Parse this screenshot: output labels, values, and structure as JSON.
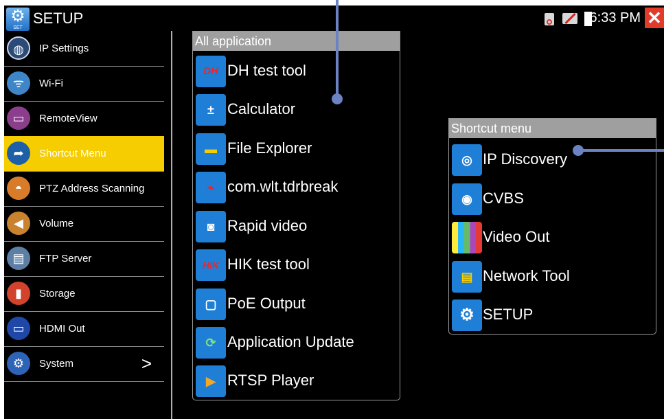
{
  "window": {
    "title": "SETUP",
    "icon": "setup-gear-icon",
    "icon_caption": "SET"
  },
  "status_bar": {
    "time": "6:33 PM",
    "icons": [
      "sd-card-icon",
      "network-disconnected-icon",
      "battery-icon"
    ],
    "close": "close-icon"
  },
  "sidebar": {
    "items": [
      {
        "label": "IP Settings",
        "icon": "globe-icon",
        "active": false
      },
      {
        "label": "Wi-Fi",
        "icon": "wifi-antenna-icon",
        "active": false
      },
      {
        "label": "RemoteView",
        "icon": "remote-view-icon",
        "active": false
      },
      {
        "label": "Shortcut Menu",
        "icon": "shortcut-icon",
        "active": true
      },
      {
        "label": "PTZ Address Scanning",
        "icon": "ptz-camera-icon",
        "active": false
      },
      {
        "label": "Volume",
        "icon": "speaker-icon",
        "active": false
      },
      {
        "label": "FTP Server",
        "icon": "ftp-server-icon",
        "active": false
      },
      {
        "label": "Storage",
        "icon": "storage-card-icon",
        "active": false
      },
      {
        "label": "HDMI Out",
        "icon": "hdmi-icon",
        "active": false
      },
      {
        "label": "System",
        "icon": "system-icon",
        "active": false,
        "chevron": ">"
      }
    ]
  },
  "all_apps": {
    "header": "All application",
    "items": [
      {
        "label": "DH test tool",
        "icon": "dh-icon",
        "glyph": "DH"
      },
      {
        "label": "Calculator",
        "icon": "calculator-icon",
        "glyph": "±"
      },
      {
        "label": "File Explorer",
        "icon": "folder-icon",
        "glyph": "▬"
      },
      {
        "label": "com.wlt.tdrbreak",
        "icon": "tdr-icon",
        "glyph": "⌁"
      },
      {
        "label": "Rapid video",
        "icon": "camera-icon",
        "glyph": "◙"
      },
      {
        "label": "HIK test tool",
        "icon": "hik-icon",
        "glyph": "HIK"
      },
      {
        "label": "PoE Output",
        "icon": "poe-icon",
        "glyph": "▢"
      },
      {
        "label": "Application Update",
        "icon": "update-icon",
        "glyph": "⟳"
      },
      {
        "label": "RTSP Player",
        "icon": "play-icon",
        "glyph": "▶"
      }
    ]
  },
  "shortcut_menu": {
    "header": "Shortcut menu",
    "items": [
      {
        "label": "IP Discovery",
        "icon": "ip-discovery-icon",
        "glyph": "◎"
      },
      {
        "label": "CVBS",
        "icon": "dome-camera-icon",
        "glyph": "◉"
      },
      {
        "label": "Video Out",
        "icon": "color-bars-icon",
        "glyph": "▮"
      },
      {
        "label": "Network Tool",
        "icon": "network-tool-icon",
        "glyph": "▤"
      },
      {
        "label": "SETUP",
        "icon": "setup-gear-icon",
        "glyph": "⚙"
      }
    ]
  },
  "colors": {
    "active_highlight": "#f5cd00",
    "panel_header": "#9f9f9f",
    "icon_blue": "#1f7fd6",
    "callout": "#6b82c4"
  }
}
